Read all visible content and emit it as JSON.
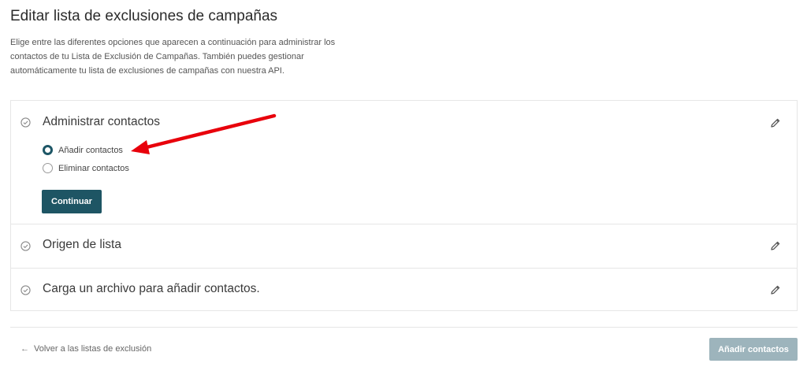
{
  "page": {
    "title": "Editar lista de exclusiones de campañas",
    "description": "Elige entre las diferentes opciones que aparecen a continuación para administrar los contactos de tu Lista de Exclusión de Campañas. También puedes gestionar automáticamente tu lista de exclusiones de campañas con nuestra API."
  },
  "steps": [
    {
      "title": "Administrar contactos",
      "options": [
        {
          "label": "Añadir contactos",
          "checked": true
        },
        {
          "label": "Eliminar contactos",
          "checked": false
        }
      ],
      "continue_label": "Continuar"
    },
    {
      "title": "Origen de lista"
    },
    {
      "title": "Carga un archivo para añadir contactos."
    }
  ],
  "footer": {
    "back_arrow": "←",
    "back_label": "Volver a las listas de exclusión",
    "add_contacts_label": "Añadir contactos"
  },
  "colors": {
    "primary": "#1e5564",
    "disabled": "#9db4bc",
    "annotation": "#e8000b"
  },
  "icons": [
    "check-circle-icon",
    "pencil-icon",
    "arrow-left-icon"
  ]
}
